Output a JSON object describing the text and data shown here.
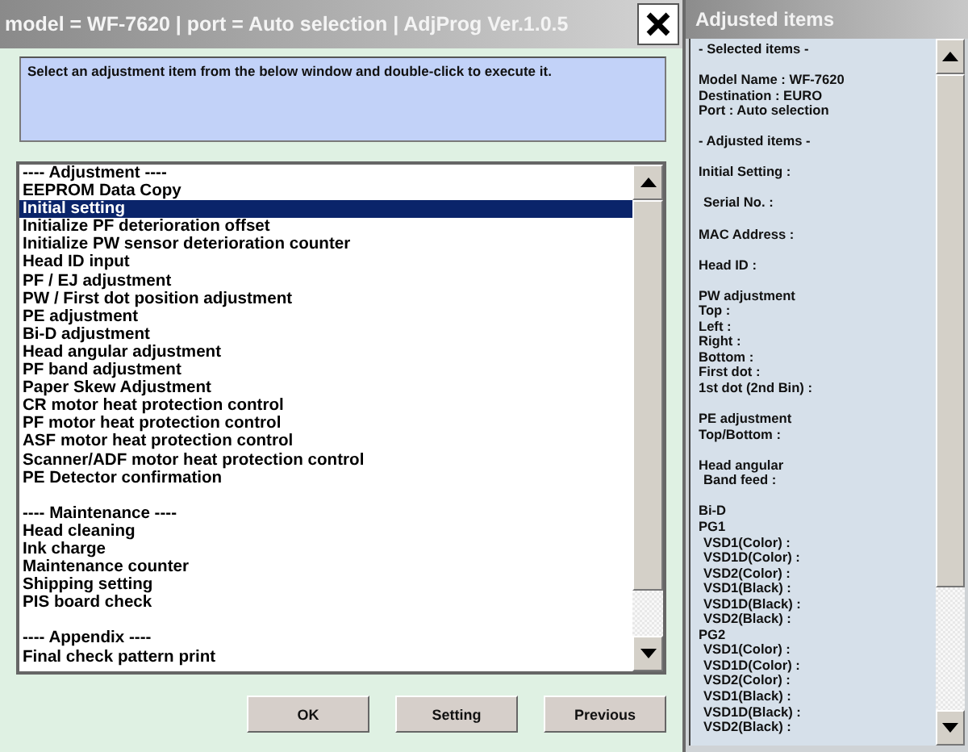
{
  "window": {
    "title": "model = WF-7620 | port = Auto selection | AdjProg Ver.1.0.5"
  },
  "instruction": "Select an adjustment item from the below window and double-click to execute it.",
  "adjustment_list": [
    {
      "header": "---- Adjustment ----",
      "items": [
        {
          "label": "EEPROM Data Copy",
          "selected": false
        },
        {
          "label": "Initial setting",
          "selected": true
        },
        {
          "label": "Initialize PF deterioration offset",
          "selected": false
        },
        {
          "label": "Initialize PW sensor deterioration counter",
          "selected": false
        },
        {
          "label": "Head ID input",
          "selected": false
        },
        {
          "label": "PF / EJ adjustment",
          "selected": false
        },
        {
          "label": "PW / First dot position adjustment",
          "selected": false
        },
        {
          "label": "PE adjustment",
          "selected": false
        },
        {
          "label": "Bi-D adjustment",
          "selected": false
        },
        {
          "label": "Head angular adjustment",
          "selected": false
        },
        {
          "label": "PF band adjustment",
          "selected": false
        },
        {
          "label": "Paper Skew Adjustment",
          "selected": false
        },
        {
          "label": "CR motor heat protection control",
          "selected": false
        },
        {
          "label": "PF motor heat protection control",
          "selected": false
        },
        {
          "label": "ASF motor heat protection control",
          "selected": false
        },
        {
          "label": "Scanner/ADF motor heat protection control",
          "selected": false
        },
        {
          "label": "PE Detector confirmation",
          "selected": false
        }
      ]
    },
    {
      "header": "---- Maintenance ----",
      "items": [
        {
          "label": "Head cleaning",
          "selected": false
        },
        {
          "label": "Ink charge",
          "selected": false
        },
        {
          "label": "Maintenance counter",
          "selected": false
        },
        {
          "label": "Shipping setting",
          "selected": false
        },
        {
          "label": "PIS board check",
          "selected": false
        }
      ]
    },
    {
      "header": "---- Appendix ----",
      "items": [
        {
          "label": "Final check pattern print",
          "selected": false
        }
      ]
    }
  ],
  "buttons": [
    "OK",
    "Setting",
    "Previous"
  ],
  "adjusted_panel": {
    "title": "Adjusted items",
    "groups": [
      {
        "lines": [
          {
            "text": "- Selected items -",
            "indented": false
          }
        ]
      },
      {
        "lines": [
          {
            "text": "Model Name : WF-7620",
            "indented": false
          },
          {
            "text": "Destination : EURO",
            "indented": false
          },
          {
            "text": "Port : Auto selection",
            "indented": false
          }
        ]
      },
      {
        "lines": [
          {
            "text": "- Adjusted items -",
            "indented": false
          }
        ]
      },
      {
        "lines": [
          {
            "text": "Initial Setting :",
            "indented": false
          }
        ]
      },
      {
        "lines": [
          {
            "text": "Serial No. :",
            "indented": true
          }
        ]
      },
      {
        "lines": [
          {
            "text": "MAC Address :",
            "indented": false
          }
        ]
      },
      {
        "lines": [
          {
            "text": "Head ID :",
            "indented": false
          }
        ]
      },
      {
        "lines": [
          {
            "text": "PW adjustment",
            "indented": false
          },
          {
            "text": "Top :",
            "indented": false
          },
          {
            "text": "Left :",
            "indented": false
          },
          {
            "text": "Right :",
            "indented": false
          },
          {
            "text": "Bottom :",
            "indented": false
          },
          {
            "text": "First dot :",
            "indented": false
          },
          {
            "text": "1st dot (2nd Bin) :",
            "indented": false
          }
        ]
      },
      {
        "lines": [
          {
            "text": "PE adjustment",
            "indented": false
          },
          {
            "text": "Top/Bottom :",
            "indented": false
          }
        ]
      },
      {
        "lines": [
          {
            "text": "Head angular",
            "indented": false
          },
          {
            "text": "Band feed :",
            "indented": true
          }
        ]
      },
      {
        "lines": [
          {
            "text": "Bi-D",
            "indented": false
          },
          {
            "text": "PG1",
            "indented": false
          },
          {
            "text": "VSD1(Color) :",
            "indented": true
          },
          {
            "text": "VSD1D(Color) :",
            "indented": true
          },
          {
            "text": "VSD2(Color) :",
            "indented": true
          },
          {
            "text": "VSD1(Black) :",
            "indented": true
          },
          {
            "text": "VSD1D(Black) :",
            "indented": true
          },
          {
            "text": "VSD2(Black) :",
            "indented": true
          },
          {
            "text": "PG2",
            "indented": false
          },
          {
            "text": "VSD1(Color) :",
            "indented": true
          },
          {
            "text": "VSD1D(Color) :",
            "indented": true
          },
          {
            "text": "VSD2(Color) :",
            "indented": true
          },
          {
            "text": "VSD1(Black) :",
            "indented": true
          },
          {
            "text": "VSD1D(Black) :",
            "indented": true
          },
          {
            "text": "VSD2(Black) :",
            "indented": true
          }
        ]
      }
    ]
  }
}
